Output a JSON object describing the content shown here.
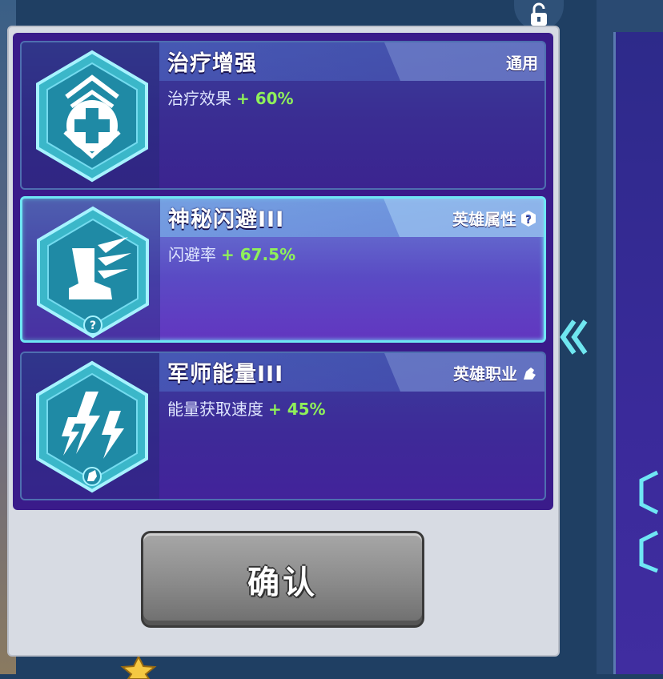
{
  "colors": {
    "bonus_green": "#8ff05a",
    "panel_purple": "#3a1b8a",
    "selected_border": "#6fe6f4",
    "dialog_bg": "#d7dbe3"
  },
  "skills": [
    {
      "title": "治疗增强",
      "tag": "通用",
      "tag_icon": null,
      "icon": "heal-cross-icon",
      "desc_label": "治疗效果",
      "desc_bonus": "+ 60%",
      "selected": false
    },
    {
      "title": "神秘闪避III",
      "tag": "英雄属性",
      "tag_icon": "question-icon",
      "icon": "winged-boot-icon",
      "desc_label": "闪避率",
      "desc_bonus": "+ 67.5%",
      "selected": true
    },
    {
      "title": "军师能量III",
      "tag": "英雄职业",
      "tag_icon": "class-icon",
      "icon": "lightning-icon",
      "desc_label": "能量获取速度",
      "desc_bonus": "+ 45%",
      "selected": false
    }
  ],
  "confirm_label": "确认"
}
